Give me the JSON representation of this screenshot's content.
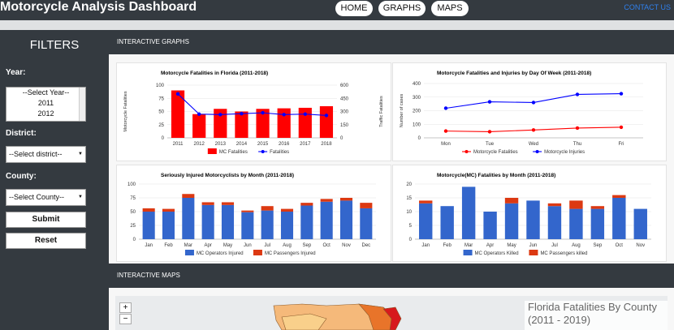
{
  "header": {
    "title": "Motorcycle Analysis Dashboard",
    "nav": [
      {
        "label": "HOME"
      },
      {
        "label": "GRAPHS"
      },
      {
        "label": "MAPS"
      }
    ],
    "contact": "CONTACT US"
  },
  "sidebar": {
    "heading": "FILTERS",
    "year_label": "Year:",
    "year_options": [
      "--Select Year--",
      "2011",
      "2012"
    ],
    "district_label": "District:",
    "district_value": "--Select district--",
    "county_label": "County:",
    "county_value": "--Select County--",
    "submit": "Submit",
    "reset": "Reset"
  },
  "sections": {
    "graphs": "INTERACTIVE GRAPHS",
    "maps": "INTERACTIVE MAPS"
  },
  "map": {
    "title_line1": "Florida Fatalities By County",
    "title_line2": "(2011 - 2019)",
    "zoom_in": "+",
    "zoom_out": "−"
  },
  "colors": {
    "red": "#ff0000",
    "blue": "#0000ff",
    "bar_blue": "#3366cc",
    "bar_red": "#dc3912",
    "dark": "#343a40"
  },
  "chart_data": [
    {
      "type": "bar",
      "title": "Motorcycle Fatalities in Florida (2011-2018)",
      "categories": [
        "2011",
        "2012",
        "2013",
        "2014",
        "2015",
        "2016",
        "2017",
        "2018"
      ],
      "ylabel": "Motorcycle Fatalities",
      "y2label": "Traffic Fatalities",
      "ylim": [
        0,
        100
      ],
      "y2lim": [
        0,
        600
      ],
      "yticks": [
        0,
        25,
        50,
        75,
        100
      ],
      "y2ticks": [
        0,
        150,
        300,
        450,
        600
      ],
      "series": [
        {
          "name": "MC Fatalities",
          "kind": "bar",
          "color": "#ff0000",
          "values": [
            90,
            45,
            55,
            50,
            55,
            56,
            57,
            60
          ]
        },
        {
          "name": "Fatalities",
          "kind": "line",
          "axis": "right",
          "color": "#0000ff",
          "values": [
            500,
            270,
            265,
            275,
            285,
            265,
            270,
            255
          ]
        }
      ],
      "legend": "bottom"
    },
    {
      "type": "line",
      "title": "Motorcycle Fatalities and Injuries by Day Of Week (2011-2018)",
      "categories": [
        "Mon",
        "Tue",
        "Wed",
        "Thu",
        "Fri"
      ],
      "ylabel": "Number of cases",
      "ylim": [
        0,
        400
      ],
      "yticks": [
        0,
        100,
        200,
        300,
        400
      ],
      "series": [
        {
          "name": "Motorcycle Fatalities",
          "color": "#ff0000",
          "values": [
            50,
            45,
            58,
            72,
            78
          ]
        },
        {
          "name": "Motorcycle Injuries",
          "color": "#0000ff",
          "values": [
            218,
            265,
            260,
            320,
            325
          ]
        }
      ],
      "legend": "bottom"
    },
    {
      "type": "bar",
      "stacked": true,
      "title": "Seriously Injured Motorcyclists by Month (2011-2018)",
      "categories": [
        "Jan",
        "Feb",
        "Mar",
        "Apr",
        "May",
        "Jun",
        "Jul",
        "Aug",
        "Sep",
        "Oct",
        "Nov",
        "Dec"
      ],
      "ylim": [
        0,
        100
      ],
      "yticks": [
        0,
        25,
        50,
        75,
        100
      ],
      "series": [
        {
          "name": "MC Operators Injured",
          "color": "#3366cc",
          "values": [
            50,
            50,
            75,
            62,
            62,
            49,
            52,
            50,
            61,
            68,
            70,
            56
          ]
        },
        {
          "name": "MC Passengers Injured",
          "color": "#dc3912",
          "values": [
            6,
            5,
            7,
            5,
            5,
            3,
            8,
            5,
            5,
            5,
            5,
            10
          ]
        }
      ],
      "legend": "bottom"
    },
    {
      "type": "bar",
      "stacked": true,
      "title": "Motorcycle(MC) Fatalities by Month (2011-2018)",
      "categories": [
        "Jan",
        "Feb",
        "Mar",
        "Apr",
        "May",
        "Jun",
        "Jul",
        "Aug",
        "Sep",
        "Oct",
        "Nov"
      ],
      "ylim": [
        0,
        20
      ],
      "yticks": [
        0,
        5,
        10,
        15,
        20
      ],
      "series": [
        {
          "name": "MC Operators Killed",
          "color": "#3366cc",
          "values": [
            13,
            12,
            19,
            10,
            13,
            14,
            12,
            11,
            11,
            15,
            11
          ]
        },
        {
          "name": "MC Passengers killed",
          "color": "#dc3912",
          "values": [
            1,
            0,
            0,
            0,
            2,
            0,
            1,
            3,
            1,
            1,
            0
          ]
        }
      ],
      "legend": "bottom"
    }
  ]
}
